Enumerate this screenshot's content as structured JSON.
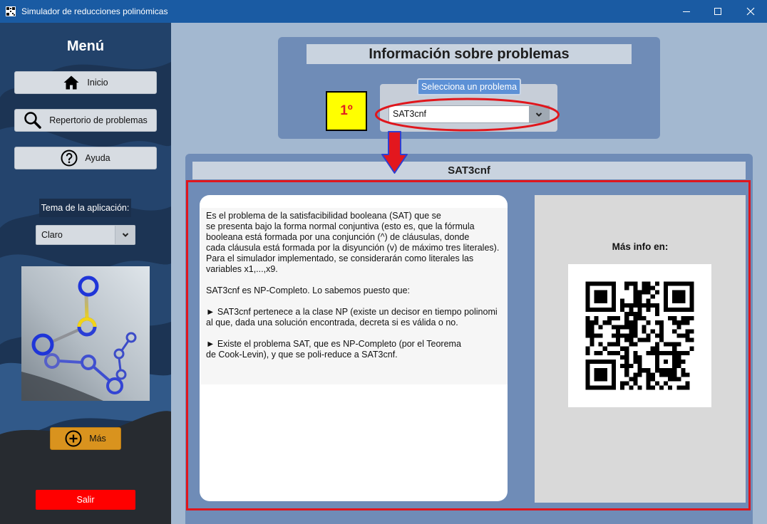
{
  "window": {
    "title": "Simulador de reducciones polinómicas",
    "icons": {
      "app": "app-icon",
      "minimize": "minimize-icon",
      "maximize": "maximize-icon",
      "close": "close-icon"
    }
  },
  "sidebar": {
    "heading": "Menú",
    "nav": [
      {
        "label": "Inicio",
        "icon": "home-icon"
      },
      {
        "label": "Repertorio de problemas",
        "icon": "search-icon"
      },
      {
        "label": "Ayuda",
        "icon": "help-icon"
      }
    ],
    "theme": {
      "label": "Tema de la aplicación:",
      "selected": "Claro",
      "icon": "chevron-down-icon"
    },
    "more": {
      "label": "Más",
      "icon": "plus-circle-icon"
    },
    "exit": {
      "label": "Salir"
    }
  },
  "info_panel": {
    "title": "Información sobre problemas",
    "step_badge": "1º",
    "selector": {
      "label": "Selecciona un problema",
      "selected": "SAT3cnf",
      "icon": "chevron-down-icon"
    }
  },
  "problem_panel": {
    "title": "SAT3cnf",
    "description": "Es el problema de la satisfacibilidad booleana (SAT) que se\nse presenta bajo la forma normal conjuntiva (esto es, que la fórmula\nbooleana está formada por una conjunción (^) de cláusulas, donde\ncada cláusula está formada por la disyunción (v) de máximo tres literales).\nPara el simulador implementado, se considerarán como literales las\nvariables x1,...,x9.\n\nSAT3cnf es NP-Completo. Lo sabemos puesto que:\n\n► SAT3cnf pertenece a la clase NP (existe un decisor en tiempo polinomi\nal que, dada una solución encontrada, decreta si es válida o no.\n\n► Existe el problema SAT, que es NP-Completo (por el Teorema\nde Cook-Levin), y que se poli-reduce a SAT3cnf.",
    "more_info": {
      "label": "Más info en:",
      "icon": "qr-code"
    }
  },
  "colors": {
    "title_bar": "#1a5ba3",
    "sidebar": "#1c3454",
    "main_background": "#a3b8d0",
    "panel": "#6f8cb7",
    "panel_header": "#c9d3df",
    "step_badge": "#ffff00",
    "step_badge_text": "#e02020",
    "selector_label": "#5d91d6",
    "more_button": "#d9931e",
    "exit_button": "#ff0000",
    "annotation_red": "#e0161c"
  }
}
